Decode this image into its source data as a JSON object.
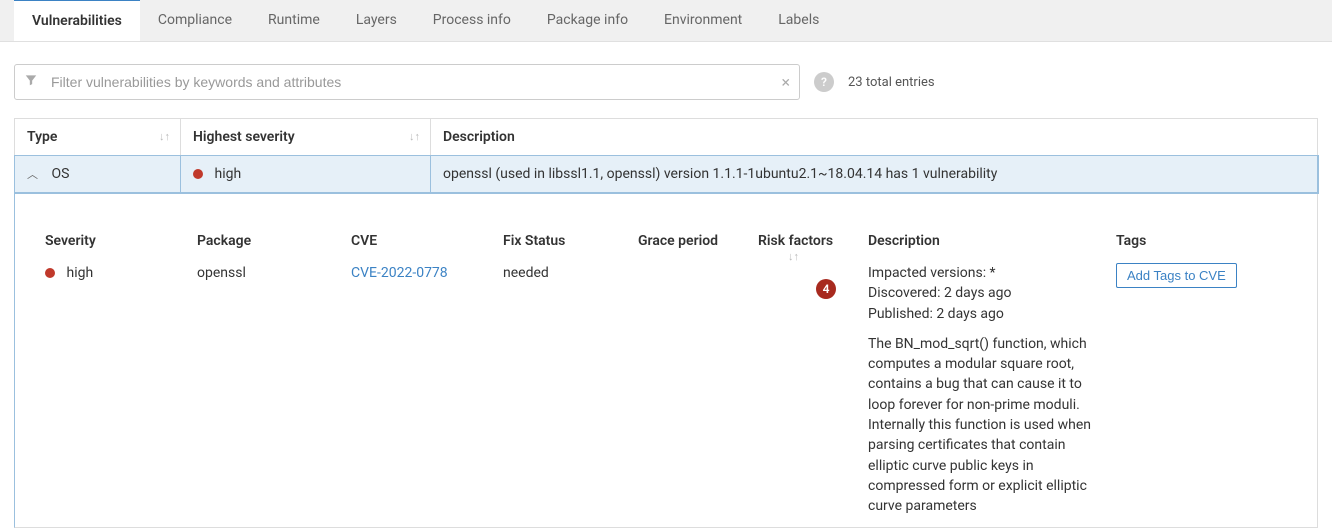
{
  "tabs": {
    "vulnerabilities": "Vulnerabilities",
    "compliance": "Compliance",
    "runtime": "Runtime",
    "layers": "Layers",
    "process_info": "Process info",
    "package_info": "Package info",
    "environment": "Environment",
    "labels": "Labels"
  },
  "filter": {
    "placeholder": "Filter vulnerabilities by keywords and attributes"
  },
  "summary": {
    "total_entries": "23 total entries"
  },
  "columns": {
    "type": "Type",
    "highest_severity": "Highest severity",
    "description": "Description"
  },
  "row": {
    "type": "OS",
    "severity_label": "high",
    "description": "openssl (used in libssl1.1, openssl) version 1.1.1-1ubuntu2.1~18.04.14 has 1 vulnerability"
  },
  "detail_headers": {
    "severity": "Severity",
    "package": "Package",
    "cve": "CVE",
    "fix_status": "Fix Status",
    "grace_period": "Grace period",
    "risk_factors": "Risk factors",
    "description": "Description",
    "tags": "Tags"
  },
  "detail": {
    "severity": "high",
    "package": "openssl",
    "cve": "CVE-2022-0778",
    "fix_status": "needed",
    "grace_period": "",
    "risk_count": "4",
    "impacted": "Impacted versions: *",
    "discovered": "Discovered: 2 days ago",
    "published": "Published: 2 days ago",
    "body": "The BN_mod_sqrt() function, which computes a modular square root, contains a bug that can cause it to loop forever for non-prime moduli. Internally this function is used when parsing certificates that contain elliptic curve public keys in compressed form or explicit elliptic curve parameters",
    "add_tags": "Add Tags to CVE"
  }
}
